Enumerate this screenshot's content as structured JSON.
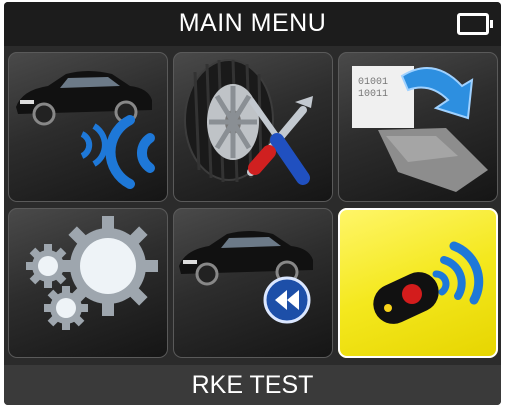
{
  "header": {
    "title": "MAIN MENU",
    "battery_icon": "battery-icon"
  },
  "menu": {
    "tiles": [
      {
        "id": "tpms-check",
        "icon": "car-sensor-signal-icon"
      },
      {
        "id": "service",
        "icon": "tire-tools-icon"
      },
      {
        "id": "programming",
        "icon": "sensor-download-icon"
      },
      {
        "id": "settings",
        "icon": "gears-icon"
      },
      {
        "id": "relearn",
        "icon": "car-rewind-icon"
      },
      {
        "id": "rke-test",
        "icon": "key-fob-signal-icon",
        "selected": true
      }
    ]
  },
  "footer": {
    "status": "RKE TEST"
  },
  "colors": {
    "selected_tile": "#f4e81e",
    "signal_blue": "#1e78d8",
    "background": "#2b2b2b"
  }
}
